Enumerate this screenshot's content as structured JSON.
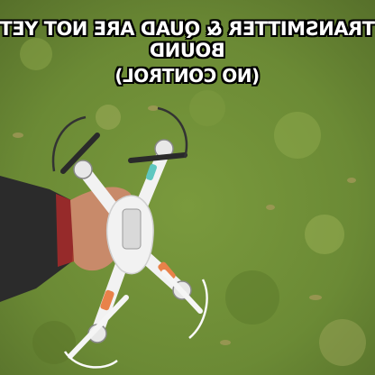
{
  "caption": {
    "line1": "TRANSMITTER & QUAD ARE NOT YET BOUND",
    "line2": "(NO CONTROL)"
  },
  "colors": {
    "grass": "#6f8f3a",
    "grass_dark": "#4e6b26",
    "drone_body": "#f2f2f2",
    "drone_accent": "#e9824a",
    "sleeve": "#2b2b2b",
    "skin": "#c88a6a"
  },
  "icons": [
    "quadcopter-drone-photo"
  ]
}
